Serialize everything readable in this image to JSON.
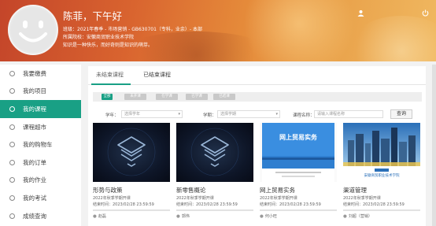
{
  "header": {
    "greeting": "陈菲，下午好",
    "line1": "班级：2021年春季 - 市场营销 - GB630701（专科，业余）- 本部",
    "line2": "所属院校：安徽商贸职业技术学院",
    "line3": "知识是一种快乐，而好奇则是知识的萌芽。",
    "user_icon": "user-icon",
    "power_icon": "power-icon"
  },
  "sidebar": {
    "items": [
      {
        "label": "我要缴费"
      },
      {
        "label": "我的项目"
      },
      {
        "label": "我的课程"
      },
      {
        "label": "课程超市"
      },
      {
        "label": "我的购物车"
      },
      {
        "label": "我的订单"
      },
      {
        "label": "我的作业"
      },
      {
        "label": "我的考试"
      },
      {
        "label": "成绩查询"
      }
    ],
    "active_index": 2,
    "active_color": "#19a085"
  },
  "main": {
    "tabs": [
      {
        "label": "未结束课程"
      },
      {
        "label": "已结束课程"
      }
    ],
    "chips": [
      {
        "label": "全部"
      },
      {
        "label": "未开课"
      },
      {
        "label": "在学课"
      },
      {
        "label": "已学课"
      },
      {
        "label": "已结课"
      }
    ],
    "filters": {
      "year_label": "学年：",
      "year_placeholder": "选择学年",
      "term_label": "学期：",
      "term_placeholder": "选择学期",
      "name_label": "课程名称：",
      "name_placeholder": "请输入课程名称",
      "search_label": "查询"
    },
    "cards": [
      {
        "title": "形势与政策",
        "term": "2022年秋季学期开课",
        "end": "结束时间：2023/02/28 23:59:59",
        "teacher": "赵磊"
      },
      {
        "title": "新零售概论",
        "term": "2022年秋季学期开课",
        "end": "结束时间：2023/02/28 23:59:59",
        "teacher": "郭伟"
      },
      {
        "title": "网上贸易实务",
        "term": "2022年秋季学期开课",
        "end": "结束时间：2023/02/28 23:59:59",
        "teacher": "何小旺",
        "thumb_text": "网上贸易实务"
      },
      {
        "title": "渠道管理",
        "term": "2022年秋季学期开课",
        "end": "结束时间：2023/02/28 23:59:59",
        "teacher": "刘超（营销）",
        "thumb_text": "安徽商贸职业技术学院"
      }
    ]
  }
}
